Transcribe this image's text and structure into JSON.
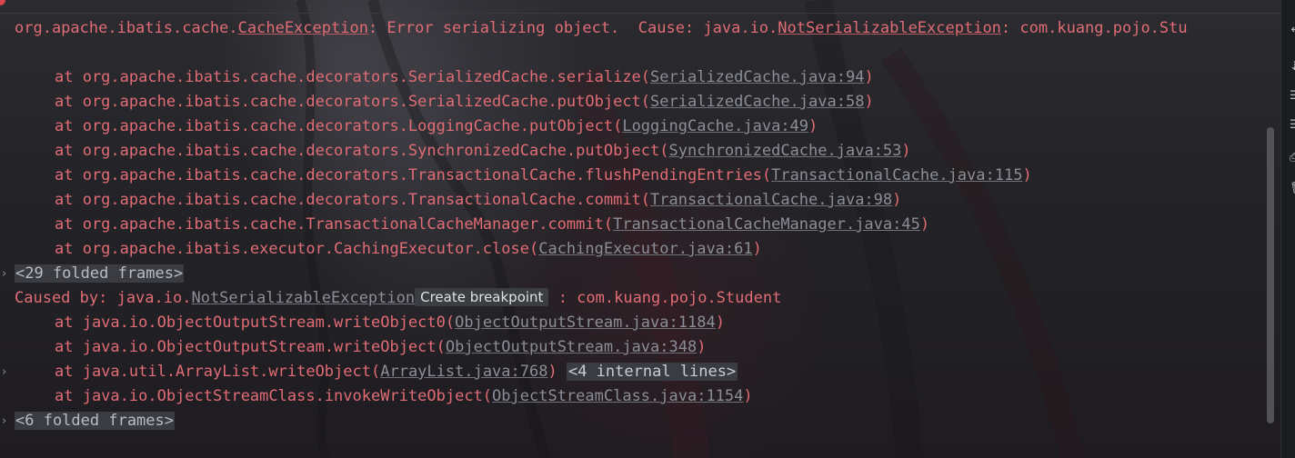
{
  "console": {
    "header_line": {
      "prefix": "org.apache.ibatis.cache.",
      "exception_link": "CacheException",
      "message": ": Error serializing object.  Cause: java.io.",
      "cause_link": "NotSerializableException",
      "suffix": ": com.kuang.pojo.Stu"
    },
    "frames_top": [
      {
        "method": "at org.apache.ibatis.cache.decorators.SerializedCache.serialize(",
        "source": "SerializedCache.java:94",
        "close": ")"
      },
      {
        "method": "at org.apache.ibatis.cache.decorators.SerializedCache.putObject(",
        "source": "SerializedCache.java:58",
        "close": ")"
      },
      {
        "method": "at org.apache.ibatis.cache.decorators.LoggingCache.putObject(",
        "source": "LoggingCache.java:49",
        "close": ")"
      },
      {
        "method": "at org.apache.ibatis.cache.decorators.SynchronizedCache.putObject(",
        "source": "SynchronizedCache.java:53",
        "close": ")"
      },
      {
        "method": "at org.apache.ibatis.cache.decorators.TransactionalCache.flushPendingEntries(",
        "source": "TransactionalCache.java:115",
        "close": ")"
      },
      {
        "method": "at org.apache.ibatis.cache.decorators.TransactionalCache.commit(",
        "source": "TransactionalCache.java:98",
        "close": ")"
      },
      {
        "method": "at org.apache.ibatis.cache.TransactionalCacheManager.commit(",
        "source": "TransactionalCacheManager.java:45",
        "close": ")"
      },
      {
        "method": "at org.apache.ibatis.executor.CachingExecutor.close(",
        "source": "CachingExecutor.java:61",
        "close": ")"
      }
    ],
    "folded_frames_1": "<29 folded frames>",
    "caused_by": {
      "prefix": "Caused by: java.io.",
      "exception_link": "NotSerializableException",
      "tooltip": "Create breakpoint",
      "suffix": " : com.kuang.pojo.Student"
    },
    "frames_cause": [
      {
        "method": "at java.io.ObjectOutputStream.writeObject0(",
        "source": "ObjectOutputStream.java:1184",
        "close": ")"
      },
      {
        "method": "at java.io.ObjectOutputStream.writeObject(",
        "source": "ObjectOutputStream.java:348",
        "close": ")"
      },
      {
        "method": "at java.util.ArrayList.writeObject(",
        "source": "ArrayList.java:768",
        "close": ")",
        "internal": "<4 internal lines>"
      },
      {
        "method": "at java.io.ObjectStreamClass.invokeWriteObject(",
        "source": "ObjectStreamClass.java:1154",
        "close": ")"
      }
    ],
    "folded_frames_2": "<6 folded frames>"
  },
  "colors": {
    "error_text": "#e06c75",
    "link_text": "#8b8e97",
    "fold_bg": "#3a3c42"
  },
  "icons": {
    "chevron": "chevron-right-icon",
    "rail": [
      "wrap-icon",
      "align-icon",
      "align-icon",
      "print-icon",
      "trash-icon"
    ]
  }
}
